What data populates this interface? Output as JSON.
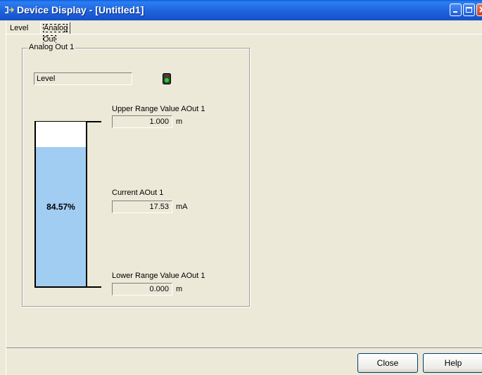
{
  "window": {
    "title": "Device Display - [Untitled1]"
  },
  "tabs": [
    {
      "label": "Level",
      "active": false
    },
    {
      "label": "Analog Out",
      "active": true
    }
  ],
  "group": {
    "label": "Analog Out 1",
    "source_value": "Level",
    "status_led": "green-led-icon",
    "upper": {
      "label": "Upper Range Value AOut 1",
      "value": "1.000",
      "unit": "m"
    },
    "current": {
      "label": "Current AOut 1",
      "value": "17.53",
      "unit": "mA"
    },
    "lower": {
      "label": "Lower Range Value AOut 1",
      "value": "0.000",
      "unit": "m"
    },
    "tank": {
      "percent_label": "84.57%",
      "fill_fraction": 0.8457,
      "fill_color": "#A2CDF2"
    }
  },
  "buttons": {
    "close": "Close",
    "help": "Help"
  }
}
